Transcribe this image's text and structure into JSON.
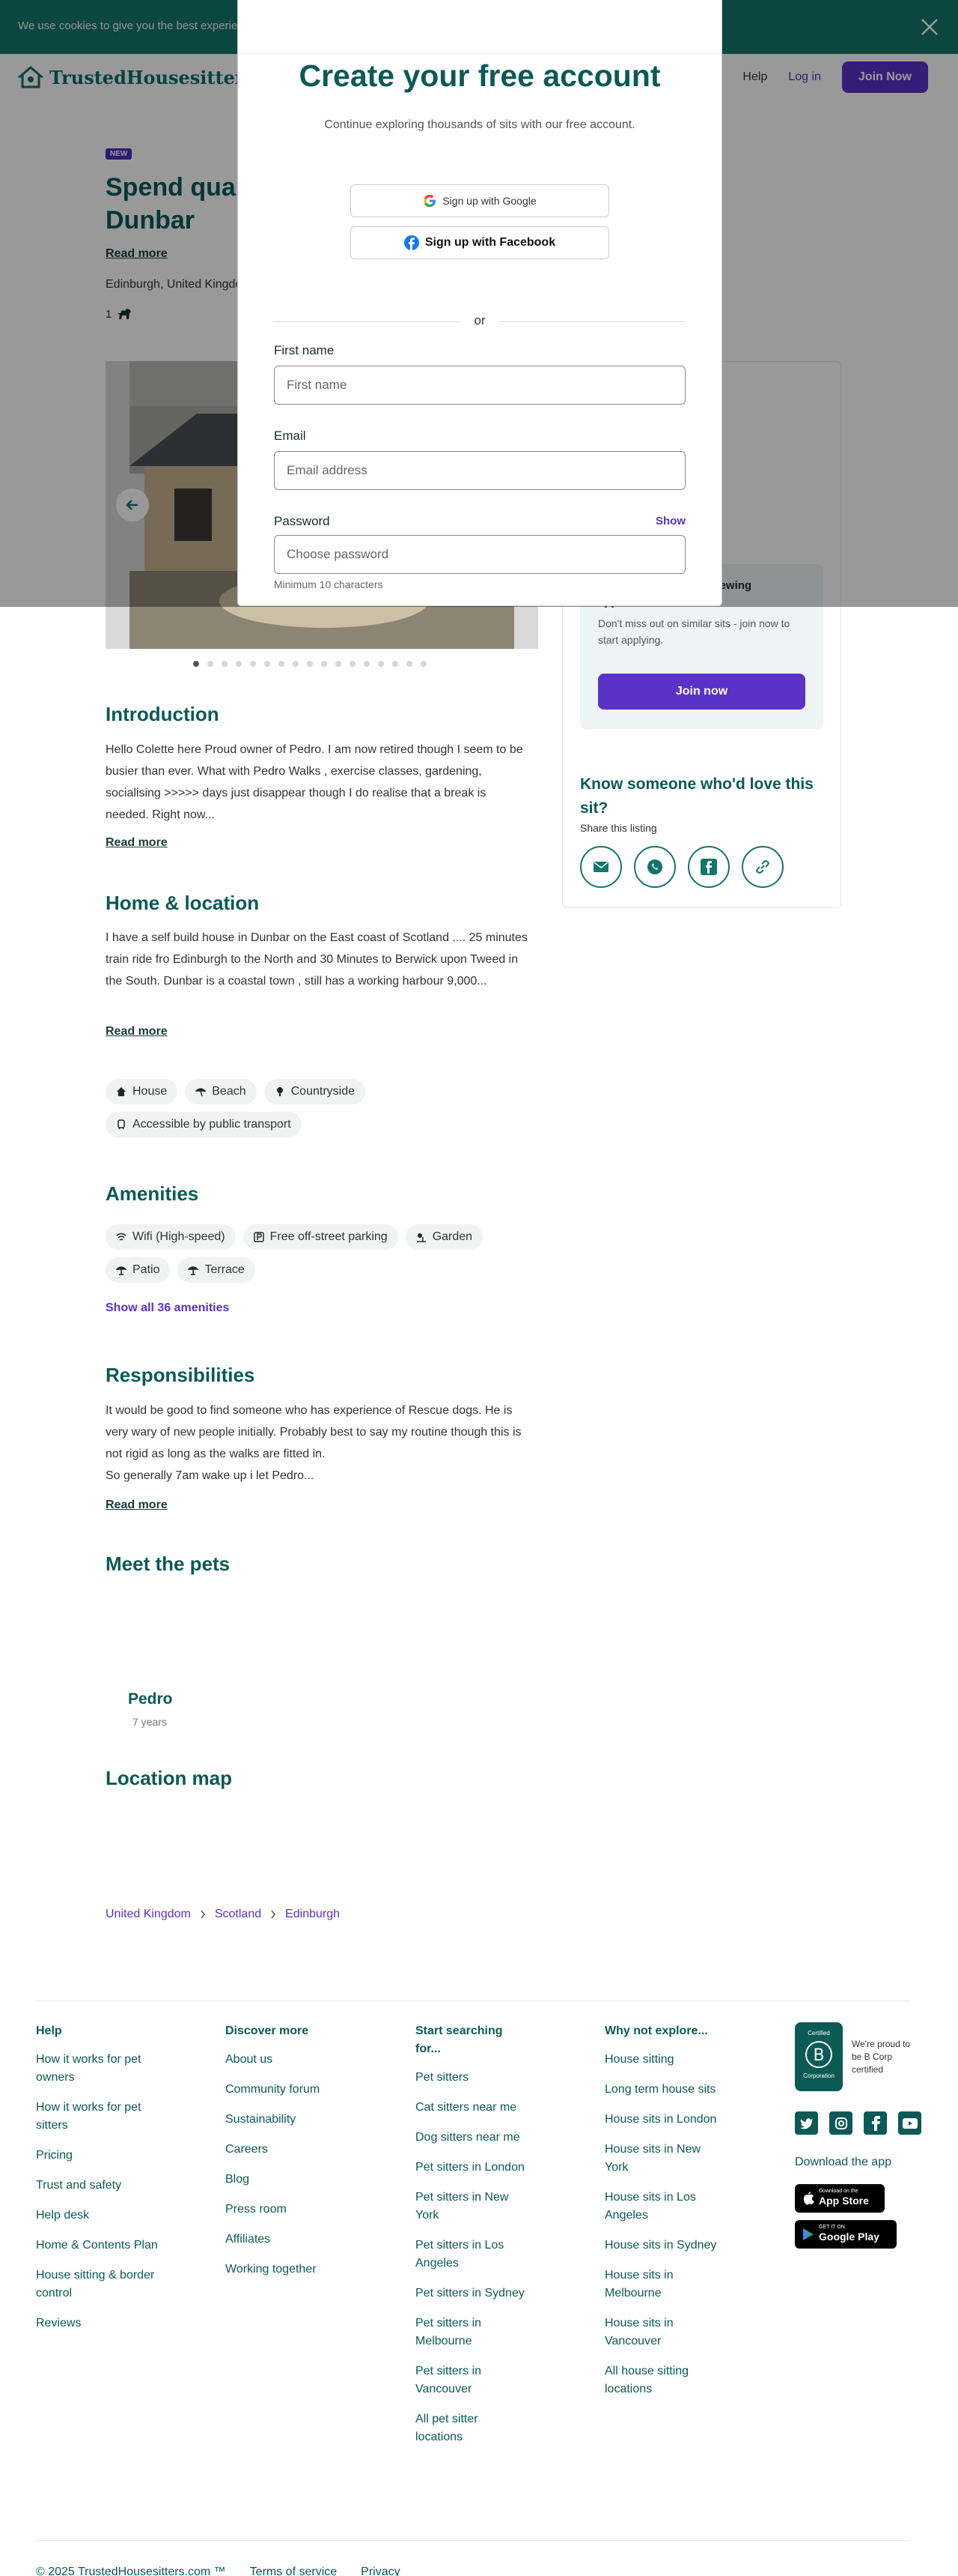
{
  "cookie": {
    "text": "We use cookies to give you the best experience"
  },
  "header": {
    "brand": "TrustedHousesitters",
    "help": "Help",
    "login": "Log in",
    "join": "Join Now"
  },
  "listing": {
    "badge": "NEW",
    "title": "Spend quality time in the seaside town of Dunbar",
    "read_more": "Read more",
    "location": "Edinburgh, United Kingdom",
    "pet_count": "1"
  },
  "sidebar": {
    "review_title": "Owner is currently reviewing applications",
    "review_text": "Don't miss out on similar sits - join now to start applying.",
    "join": "Join now",
    "share_title": "Know someone who'd love this sit?",
    "share_sub": "Share this listing"
  },
  "introduction": {
    "heading": "Introduction",
    "text": "Hello Colette here Proud owner of Pedro. I am now retired though I seem to be busier than ever. What with Pedro Walks , exercise classes, gardening, socialising >>>>> days just disappear though I do realise that a break is needed. Right now...",
    "read_more": "Read more"
  },
  "home": {
    "heading": "Home & location",
    "text": "I have a self build house in Dunbar on the East coast of Scotland .... 25 minutes train ride fro Edinburgh to the North and 30 Minutes to Berwick upon Tweed in the South. Dunbar is a coastal town , still has a working harbour 9,000...",
    "read_more": "Read more",
    "chips": [
      "House",
      "Beach",
      "Countryside",
      "Accessible by public transport"
    ]
  },
  "amenities": {
    "heading": "Amenities",
    "chips": [
      "Wifi (High-speed)",
      "Free off-street parking",
      "Garden",
      "Patio",
      "Terrace"
    ],
    "show_all": "Show all 36 amenities"
  },
  "responsibilities": {
    "heading": "Responsibilities",
    "text": "It would be good to find someone who has experience of Rescue dogs. He is very wary of new people initially. Probably best to say my routine though this is not rigid as long as the walks are fitted in.",
    "text2": "So generally 7am wake up i let Pedro...",
    "read_more": "Read more"
  },
  "pets": {
    "heading": "Meet the pets",
    "name": "Pedro",
    "age": "7 years"
  },
  "map": {
    "heading": "Location map"
  },
  "breadcrumbs": [
    "United Kingdom",
    "Scotland",
    "Edinburgh"
  ],
  "footer": {
    "help": {
      "heading": "Help",
      "items": [
        "How it works for pet owners",
        "How it works for pet sitters",
        "Pricing",
        "Trust and safety",
        "Help desk",
        "Home & Contents Plan",
        "House sitting & border control",
        "Reviews"
      ]
    },
    "discover": {
      "heading": "Discover more",
      "items": [
        "About us",
        "Community forum",
        "Sustainability",
        "Careers",
        "Blog",
        "Press room",
        "Affiliates",
        "Working together"
      ]
    },
    "start": {
      "heading": "Start searching for...",
      "items": [
        "Pet sitters",
        "Cat sitters near me",
        "Dog sitters near me",
        "Pet sitters in London",
        "Pet sitters in New York",
        "Pet sitters in Los Angeles",
        "Pet sitters in Sydney",
        "Pet sitters in Melbourne",
        "Pet sitters in Vancouver",
        "All pet sitter locations"
      ]
    },
    "explore": {
      "heading": "Why not explore...",
      "items": [
        "House sitting",
        "Long term house sits",
        "House sits in London",
        "House sits in New York",
        "House sits in Los Angeles",
        "House sits in Sydney",
        "House sits in Melbourne",
        "House sits in Vancouver",
        "All house sitting locations"
      ]
    },
    "bcorp": {
      "badge_top": "Certified",
      "badge_bottom": "Corporation",
      "text": "We're proud to be B Corp certified"
    },
    "download": "Download the app",
    "appstore": {
      "small": "Download on the",
      "big": "App Store"
    },
    "googleplay": {
      "small": "GET IT ON",
      "big": "Google Play"
    },
    "copyright": "© 2025 TrustedHousesitters.com ™",
    "terms": "Terms of service",
    "privacy": "Privacy"
  },
  "modal": {
    "title": "Create your free account",
    "subtitle": "Continue exploring thousands of sits with our free account.",
    "google": "Sign up with Google",
    "facebook": "Sign up with Facebook",
    "or": "or",
    "first_name_label": "First name",
    "first_name_placeholder": "First name",
    "email_label": "Email",
    "email_placeholder": "Email address",
    "password_label": "Password",
    "password_placeholder": "Choose password",
    "show": "Show",
    "hint": "Minimum 10 characters"
  },
  "colors": {
    "teal": "#0b5a55",
    "cookie_bar": "#14756c",
    "purple": "#5a32c8"
  }
}
